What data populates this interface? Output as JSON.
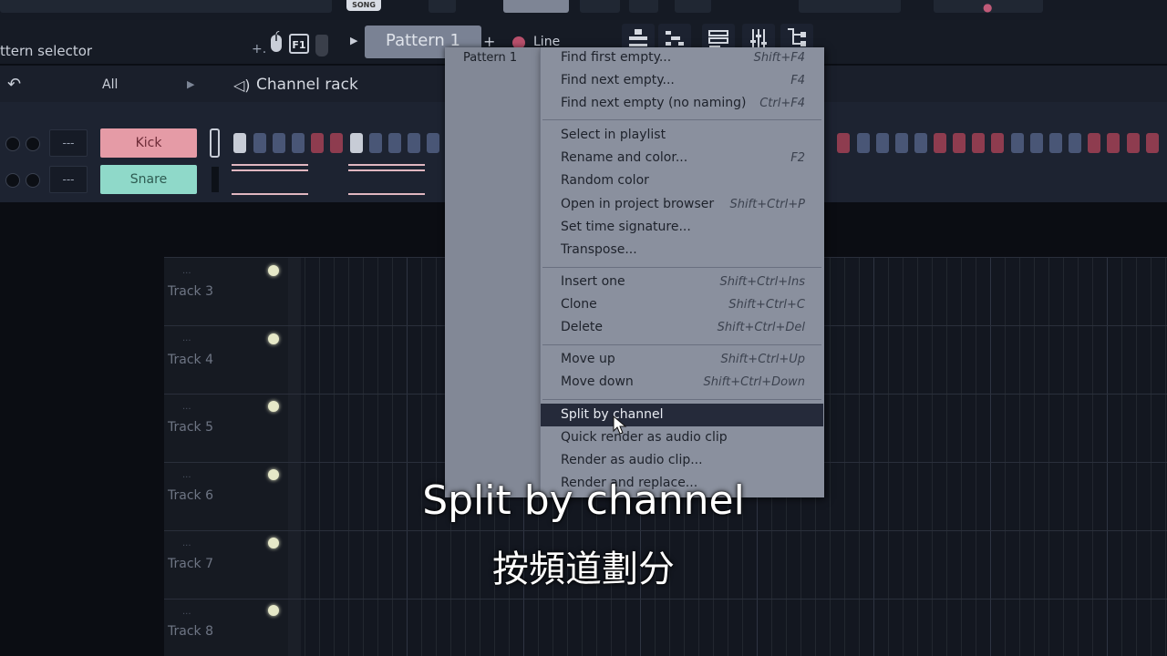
{
  "toolbar": {
    "song_badge": "SONG"
  },
  "pattern_bar": {
    "selector_label": "ttern selector",
    "f1_label": "F1",
    "pattern_name": "Pattern 1",
    "add_label": "+",
    "line_mode": "Line"
  },
  "channel_rack": {
    "filter": "All",
    "title": "Channel rack",
    "add_label": "+",
    "channels": [
      {
        "name": "Kick",
        "mixer": "---",
        "color": "#e59ba6"
      },
      {
        "name": "Snare",
        "mixer": "---",
        "color": "#8fd9c9"
      }
    ]
  },
  "playlist": {
    "tracks": [
      {
        "label": "Track 3",
        "dots": "..."
      },
      {
        "label": "Track 4",
        "dots": "..."
      },
      {
        "label": "Track 5",
        "dots": "..."
      },
      {
        "label": "Track 6",
        "dots": "..."
      },
      {
        "label": "Track 7",
        "dots": "..."
      },
      {
        "label": "Track 8",
        "dots": "..."
      }
    ]
  },
  "context_menu": {
    "pattern_list": [
      "Pattern 1"
    ],
    "items": [
      {
        "label": "Find first empty...",
        "shortcut": "Shift+F4"
      },
      {
        "label": "Find next empty...",
        "shortcut": "F4"
      },
      {
        "label": "Find next empty (no naming)",
        "shortcut": "Ctrl+F4"
      },
      {
        "label": "Select in playlist",
        "shortcut": ""
      },
      {
        "label": "Rename and color...",
        "shortcut": "F2"
      },
      {
        "label": "Random color",
        "shortcut": ""
      },
      {
        "label": "Open in project browser",
        "shortcut": "Shift+Ctrl+P"
      },
      {
        "label": "Set time signature...",
        "shortcut": ""
      },
      {
        "label": "Transpose...",
        "shortcut": ""
      },
      {
        "label": "Insert one",
        "shortcut": "Shift+Ctrl+Ins"
      },
      {
        "label": "Clone",
        "shortcut": "Shift+Ctrl+C"
      },
      {
        "label": "Delete",
        "shortcut": "Shift+Ctrl+Del"
      },
      {
        "label": "Move up",
        "shortcut": "Shift+Ctrl+Up"
      },
      {
        "label": "Move down",
        "shortcut": "Shift+Ctrl+Down"
      },
      {
        "label": "Split by channel",
        "shortcut": ""
      },
      {
        "label": "Quick render as audio clip",
        "shortcut": ""
      },
      {
        "label": "Render as audio clip...",
        "shortcut": ""
      },
      {
        "label": "Render and replace...",
        "shortcut": ""
      }
    ],
    "highlighted": "Split by channel"
  },
  "subtitles": {
    "english": "Split by channel",
    "chinese": "按頻道劃分"
  },
  "colors": {
    "accent_pink": "#b8506c",
    "menu_bg": "#8a909e",
    "menu_highlight": "#252a3a"
  }
}
